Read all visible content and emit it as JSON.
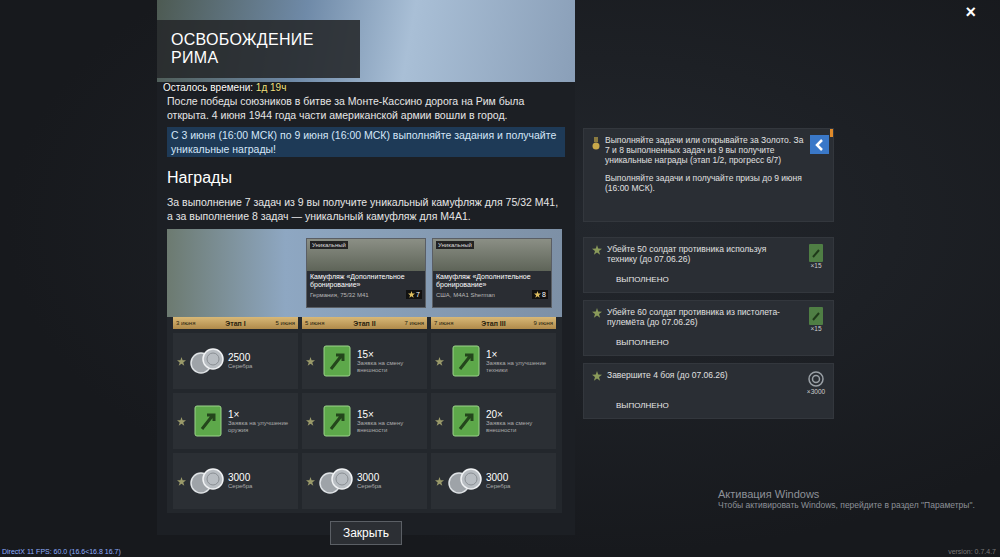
{
  "event": {
    "title": "ОСВОБОЖДЕНИЕ РИМА",
    "time_label": "Осталось времени:",
    "time_value": "1д 19ч",
    "description": "После победы союзников в битве за Монте-Кассино дорога на Рим была открыта. 4 июня 1944 года части американской армии вошли в город.",
    "highlight": "С 3 июня (16:00 МСК) по 9 июня (16:00 МСК) выполняйте задания и получайте уникальные награды!",
    "rewards_heading": "Награды",
    "rewards_text": "За выполнение 7 задач из 9 вы получите уникальный камуфляж для 75/32 M41, а за выполнение 8 задач — уникальный камуфляж для M4A1.",
    "close_button": "Закрыть"
  },
  "close_icon": "×",
  "camo_cards": [
    {
      "tag": "Уникальный",
      "name": "Камуфляж «Дополнительное бронирование»",
      "vehicle": "Германия, 75/32 M41",
      "tasks": "7"
    },
    {
      "tag": "Уникальный",
      "name": "Камуфляж «Дополнительное бронирование»",
      "vehicle": "США, M4A1 Sherman",
      "tasks": "8"
    }
  ],
  "stages": [
    {
      "start": "3 июня",
      "label": "Этап I",
      "end": "5 июня",
      "rewards": [
        {
          "kind": "silver",
          "amount": "2500",
          "label": "Серебра"
        },
        {
          "kind": "order",
          "amount": "1×",
          "label": "Заявка на улучшение оружия"
        },
        {
          "kind": "silver",
          "amount": "3000",
          "label": "Серебра"
        }
      ]
    },
    {
      "start": "5 июня",
      "label": "Этап II",
      "end": "7 июня",
      "rewards": [
        {
          "kind": "order",
          "amount": "15×",
          "label": "Заявка на смену внешности"
        },
        {
          "kind": "order",
          "amount": "15×",
          "label": "Заявка на смену внешности"
        },
        {
          "kind": "silver",
          "amount": "3000",
          "label": "Серебра"
        }
      ]
    },
    {
      "start": "7 июня",
      "label": "Этап III",
      "end": "9 июня",
      "rewards": [
        {
          "kind": "order",
          "amount": "1×",
          "label": "Заявка на улучшение техники"
        },
        {
          "kind": "order",
          "amount": "20×",
          "label": "Заявка на смену внешности"
        },
        {
          "kind": "silver",
          "amount": "3000",
          "label": "Серебра"
        }
      ]
    }
  ],
  "task_info": {
    "text": "Выполняйте задачи или открывайте за Золото. За 7 и 8 выполненных задач из 9 вы получите уникальные награды (этап 1/2, прогресс 6/7)",
    "subtext": "Выполняйте задачи и получайте призы до 9 июня (16:00 МСК)."
  },
  "tasks": [
    {
      "text": "Убейте 50 солдат противника используя технику (до 07.06.26)",
      "reward": "×15",
      "kind": "order",
      "status": "ВЫПОЛНЕНО",
      "completed": true
    },
    {
      "text": "Убейте 60 солдат противника из пистолета-пулемёта (до 07.06.26)",
      "reward": "×15",
      "kind": "order",
      "status": "ВЫПОЛНЕНО",
      "completed": true
    },
    {
      "text": "Завершите 4 боя (до 07.06.26)",
      "reward": "×3000",
      "kind": "silver",
      "status": "ВЫПОЛНЕНО",
      "completed": true
    }
  ],
  "watermark": {
    "title": "Активация Windows",
    "text": "Чтобы активировать Windows, перейдите в раздел \"Параметры\"."
  },
  "fps": "DirectX 11 FPS: 60.0 (16.6<16.8 16.7)",
  "version": "version: 0.7.4.7"
}
